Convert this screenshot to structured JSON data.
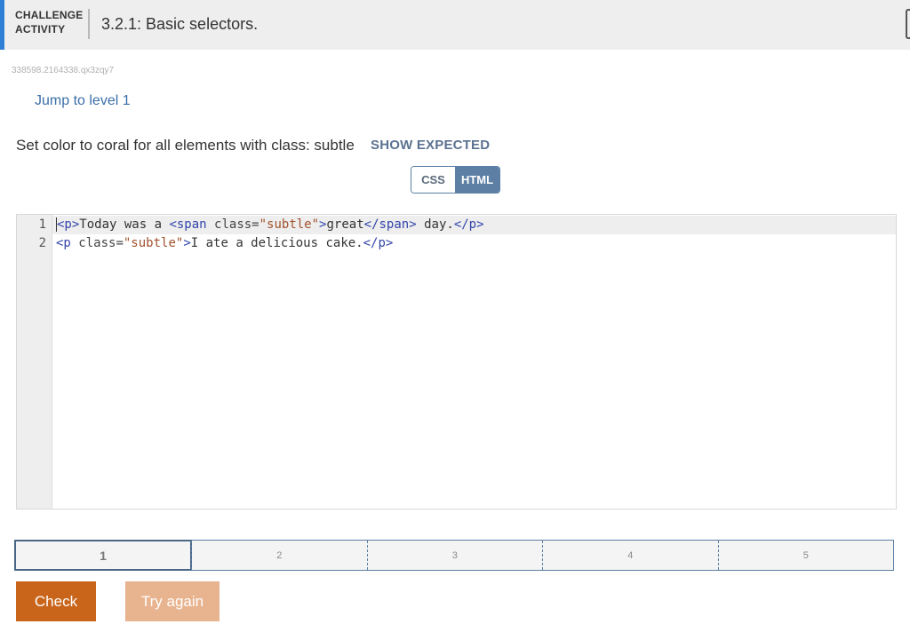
{
  "header": {
    "label_line1": "CHALLENGE",
    "label_line2": "ACTIVITY",
    "title": "3.2.1: Basic selectors."
  },
  "activity_id": "338598.2164338.qx3zqy7",
  "jump_link": "Jump to level 1",
  "instructions": "Set color to coral for all elements with class: subtle",
  "show_expected": "SHOW EXPECTED",
  "toggle": {
    "css": "CSS",
    "html": "HTML",
    "selected": "HTML"
  },
  "editor": {
    "line_numbers": [
      "1",
      "2"
    ],
    "line1": {
      "t1": "<p>",
      "t2": "Today was a ",
      "t3": "<span ",
      "t4": "class=",
      "t5": "\"subtle\"",
      "t6": ">",
      "t7": "great",
      "t8": "</span>",
      "t9": " day.",
      "t10": "</p>"
    },
    "line2": {
      "t1": "<p ",
      "t2": "class=",
      "t3": "\"subtle\"",
      "t4": ">",
      "t5": "I ate a delicious cake.",
      "t6": "</p>"
    }
  },
  "levels": [
    "1",
    "2",
    "3",
    "4",
    "5"
  ],
  "current_level": "1",
  "buttons": {
    "check": "Check",
    "try_again": "Try again"
  },
  "colors": {
    "accent": "#2f7fd6",
    "check_button": "#c9651b",
    "try_again_button": "#e8b38f",
    "toggle_selected": "#5d7fa3",
    "link": "#3b6fa8"
  }
}
